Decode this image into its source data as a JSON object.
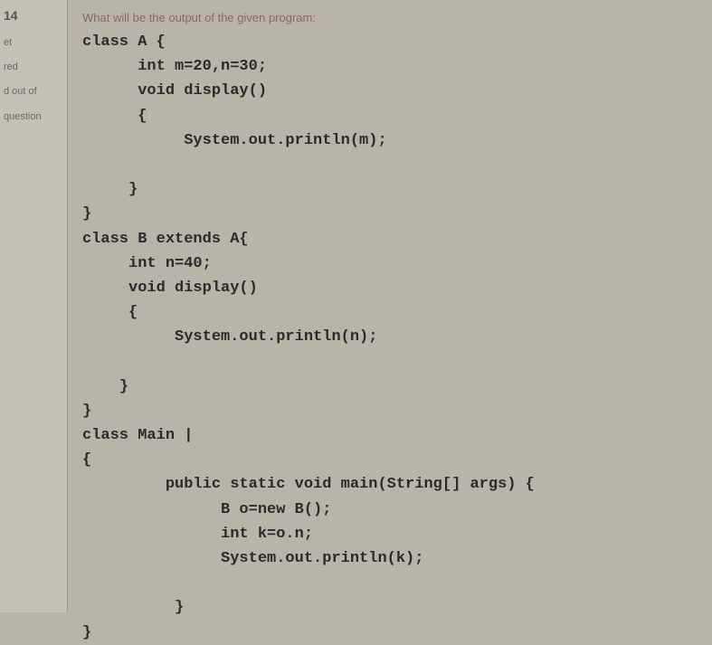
{
  "sidebar": {
    "question_number": "14",
    "status_lines": [
      "et",
      "red",
      "d out of",
      "question"
    ]
  },
  "main": {
    "prompt": "What will be the output of the given program:",
    "code": "class A {\n      int m=20,n=30;\n      void display()\n      {\n           System.out.println(m);\n\n     }\n}\nclass B extends A{\n     int n=40;\n     void display()\n     {\n          System.out.println(n);\n\n    }\n}\nclass Main |\n{\n         public static void main(String[] args) {\n               B o=new B();\n               int k=o.n;\n               System.out.println(k);\n\n          }\n}"
  }
}
